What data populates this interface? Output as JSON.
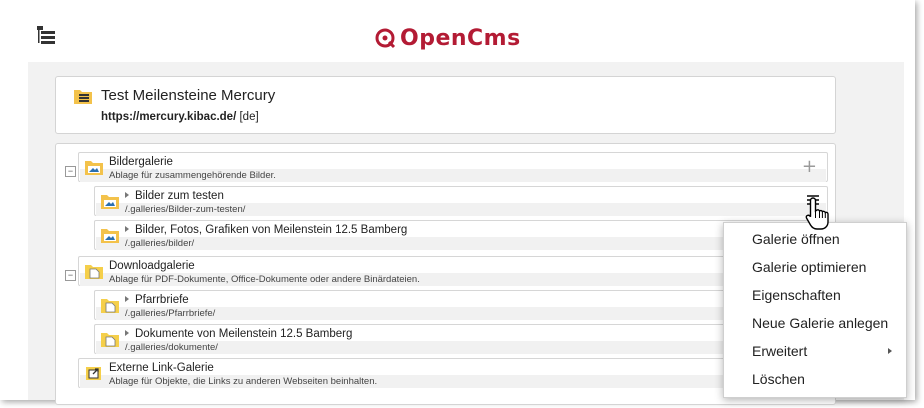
{
  "header": {
    "logo_icon": "opencms-logo-icon",
    "logo_text": "OpenCms",
    "menu_icon": "sitemap-toggle-icon"
  },
  "site": {
    "icon": "site-folder-icon",
    "title": "Test Meilensteine Mercury",
    "url": "https://mercury.kibac.de/",
    "locale": "[de]"
  },
  "tree": {
    "bildergalerie": {
      "title": "Bildergalerie",
      "description": "Ablage für zusammengehörende Bilder.",
      "add_icon": "+"
    },
    "bilder_testen": {
      "title": "Bilder zum testen",
      "path": "/.galleries/Bilder-zum-testen/"
    },
    "bilder_fotos": {
      "title": "Bilder, Fotos, Grafiken von Meilenstein 12.5 Bamberg",
      "path": "/.galleries/bilder/"
    },
    "downloadgalerie": {
      "title": "Downloadgalerie",
      "description": "Ablage für PDF-Dokumente, Office-Dokumente oder andere Binärdateien."
    },
    "pfarrbriefe": {
      "title": "Pfarrbriefe",
      "path": "/.galleries/Pfarrbriefe/"
    },
    "dokumente": {
      "title": "Dokumente von Meilenstein 12.5 Bamberg",
      "path": "/.galleries/dokumente/"
    },
    "linkgalerie": {
      "title": "Externe Link-Galerie",
      "description": "Ablage für Objekte, die Links zu anderen Webseiten beinhalten."
    }
  },
  "context_menu": {
    "items": [
      "Galerie öffnen",
      "Galerie optimieren",
      "Eigenschaften",
      "Neue Galerie anlegen",
      "Erweitert",
      "Löschen"
    ]
  },
  "colors": {
    "brand": "#b31b34",
    "image_folder": "#f3c24b",
    "doc_folder": "#f5cf4a"
  }
}
